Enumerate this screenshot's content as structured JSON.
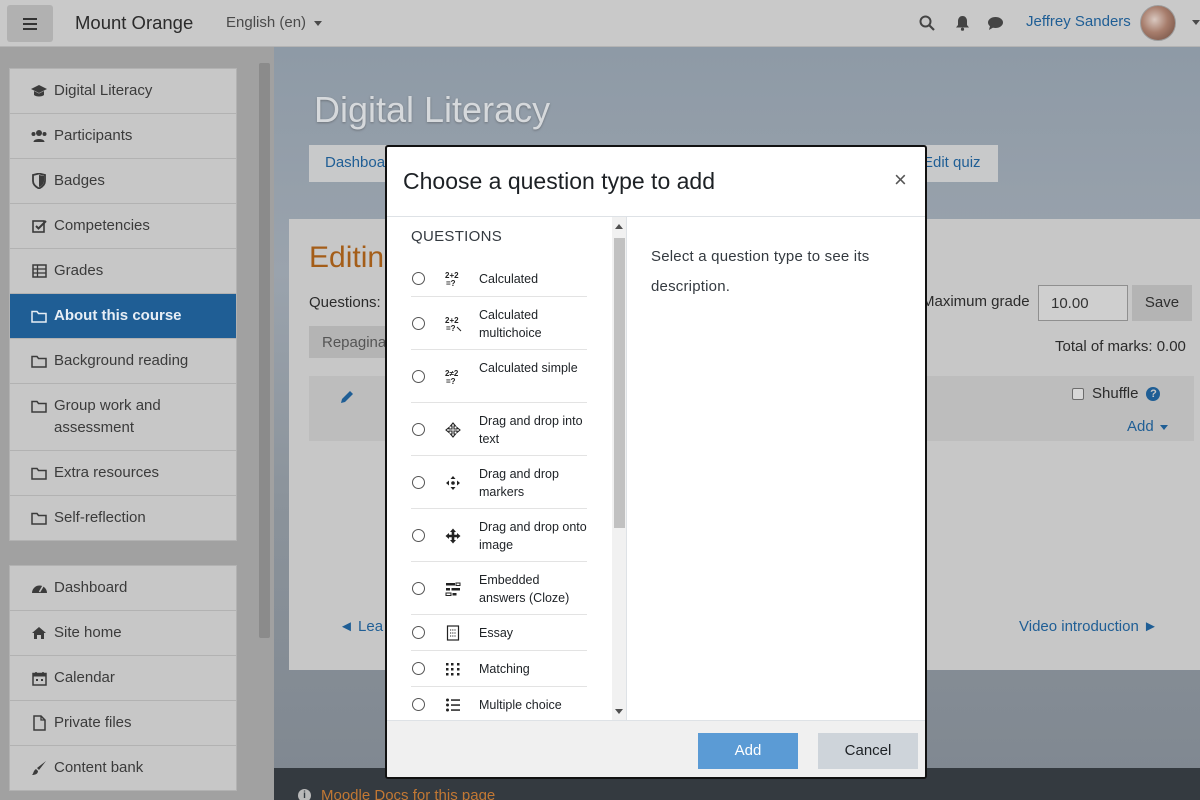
{
  "navbar": {
    "brand": "Mount Orange",
    "language": "English (en)",
    "user_name": "Jeffrey Sanders"
  },
  "drawer": {
    "course_items": [
      {
        "label": "Digital Literacy",
        "icon": "graduation-cap-icon"
      },
      {
        "label": "Participants",
        "icon": "users-icon"
      },
      {
        "label": "Badges",
        "icon": "shield-icon"
      },
      {
        "label": "Competencies",
        "icon": "check-square-icon"
      },
      {
        "label": "Grades",
        "icon": "table-icon"
      },
      {
        "label": "About this course",
        "icon": "folder-icon",
        "active": true
      },
      {
        "label": "Background reading",
        "icon": "folder-icon"
      },
      {
        "label": "Group work and assessment",
        "icon": "folder-icon"
      },
      {
        "label": "Extra resources",
        "icon": "folder-icon"
      },
      {
        "label": "Self-reflection",
        "icon": "folder-icon"
      }
    ],
    "site_items": [
      {
        "label": "Dashboard",
        "icon": "tachometer-icon"
      },
      {
        "label": "Site home",
        "icon": "home-icon"
      },
      {
        "label": "Calendar",
        "icon": "calendar-icon"
      },
      {
        "label": "Private files",
        "icon": "file-icon"
      },
      {
        "label": "Content bank",
        "icon": "paintbrush-icon"
      }
    ]
  },
  "page": {
    "title": "Digital Literacy",
    "crumb_first": "Dashboa",
    "crumb_last": "Edit quiz",
    "editing_title": "Editin",
    "questions_label": "Questions:",
    "repaginate": "Repagina",
    "max_grade_label": "Maximum grade",
    "max_grade_value": "10.00",
    "save_label": "Save",
    "total_marks": "Total of marks: 0.00",
    "shuffle_label": "Shuffle",
    "add_label": "Add",
    "prev_link": "◄ Lea",
    "next_link": "Video introduction ►",
    "footer_link": "Moodle Docs for this page"
  },
  "modal": {
    "title": "Choose a question type to add",
    "close_glyph": "×",
    "list_heading": "QUESTIONS",
    "question_types": [
      {
        "label": "Calculated",
        "icon": "calculated-icon"
      },
      {
        "label": "Calculated multichoice",
        "icon": "calculated-multichoice-icon"
      },
      {
        "label": "Calculated simple",
        "icon": "calculated-simple-icon"
      },
      {
        "label": "Drag and drop into text",
        "icon": "drag-drop-text-icon"
      },
      {
        "label": "Drag and drop markers",
        "icon": "drag-drop-markers-icon"
      },
      {
        "label": "Drag and drop onto image",
        "icon": "drag-drop-image-icon"
      },
      {
        "label": "Embedded answers (Cloze)",
        "icon": "cloze-icon"
      },
      {
        "label": "Essay",
        "icon": "essay-icon"
      },
      {
        "label": "Matching",
        "icon": "matching-icon"
      },
      {
        "label": "Multiple choice",
        "icon": "multichoice-icon"
      }
    ],
    "description": "Select a question type to see its description.",
    "add_button": "Add",
    "cancel_button": "Cancel"
  },
  "colors": {
    "primary": "#1f5e95",
    "add_button": "#5b9bd5",
    "editing_title": "#a45d18"
  }
}
